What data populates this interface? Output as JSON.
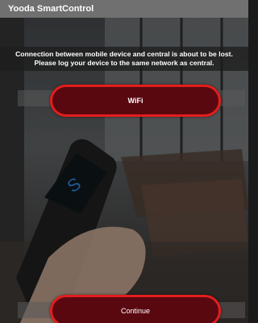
{
  "app": {
    "title": "Yooda SmartControl"
  },
  "notice": {
    "line1": "Connection between mobile device and central is about to be lost.",
    "line2": "Please log your device to the same network as central."
  },
  "buttons": {
    "wifi_label": "WiFi",
    "continue_label": "Continue"
  },
  "colors": {
    "accent": "#e41d1d",
    "button_fill": "#5a0810",
    "titlebar": "#707070"
  }
}
